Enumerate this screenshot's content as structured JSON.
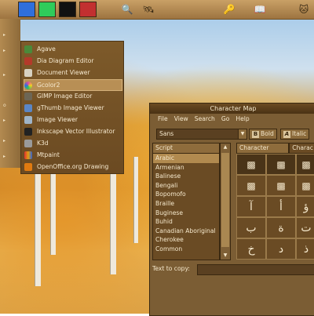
{
  "panel": {
    "workspace_colors": [
      "#2f6fdc",
      "#2fcc5a",
      "#111111",
      "#c23030"
    ],
    "icons": [
      "magnifier-icon",
      "satellite-icon",
      "dictionary-icon",
      "cat-icon"
    ]
  },
  "menu_strip": {
    "items": [
      {
        "glyph": "▸"
      },
      {
        "glyph": "▸"
      },
      {
        "glyph": "▸"
      },
      {
        "glyph": "o"
      },
      {
        "glyph": "▸"
      },
      {
        "glyph": "▸"
      },
      {
        "glyph": "▸"
      }
    ]
  },
  "submenu": {
    "items": [
      {
        "label": "Agave",
        "icon": "agave-icon",
        "color": "#4a8a3a"
      },
      {
        "label": "Dia Diagram Editor",
        "icon": "dia-icon",
        "color": "#b33a2a"
      },
      {
        "label": "Document Viewer",
        "icon": "document-viewer-icon",
        "color": "#d8d2c2"
      },
      {
        "label": "Gcolor2",
        "icon": "gcolor2-icon",
        "color": "#e04aa0"
      },
      {
        "label": "GIMP Image Editor",
        "icon": "gimp-icon",
        "color": "#6d6655"
      },
      {
        "label": "gThumb Image Viewer",
        "icon": "gthumb-icon",
        "color": "#5b86c5"
      },
      {
        "label": "Image Viewer",
        "icon": "image-viewer-icon",
        "color": "#9fb4c8"
      },
      {
        "label": "Inkscape Vector Illustrator",
        "icon": "inkscape-icon",
        "color": "#222222"
      },
      {
        "label": "K3d",
        "icon": "k3d-icon",
        "color": "#9a9a9a"
      },
      {
        "label": "Mtpaint",
        "icon": "mtpaint-icon",
        "color": "#e0a010"
      },
      {
        "label": "OpenOffice.org Drawing",
        "icon": "openoffice-draw-icon",
        "color": "#e07a10"
      }
    ]
  },
  "charmap": {
    "title": "Character Map",
    "menu": [
      "File",
      "View",
      "Search",
      "Go",
      "Help"
    ],
    "font": "Sans",
    "bold_label": "Bold",
    "italic_label": "Italic",
    "script_header": "Script",
    "scripts": [
      "Arabic",
      "Armenian",
      "Balinese",
      "Bengali",
      "Bopomofo",
      "Braille",
      "Buginese",
      "Buhid",
      "Canadian Aboriginal",
      "Cherokee",
      "Common"
    ],
    "selected_script": "Arabic",
    "tabs": [
      "Character Table",
      "Charac"
    ],
    "glyphs": [
      "",
      "",
      "",
      "",
      "",
      "",
      "آ",
      "أ",
      "ؤ",
      "ب",
      "ة",
      "ت",
      "خ",
      "د",
      "ذ"
    ],
    "copy_label": "Text to copy:",
    "copy_value": ""
  }
}
